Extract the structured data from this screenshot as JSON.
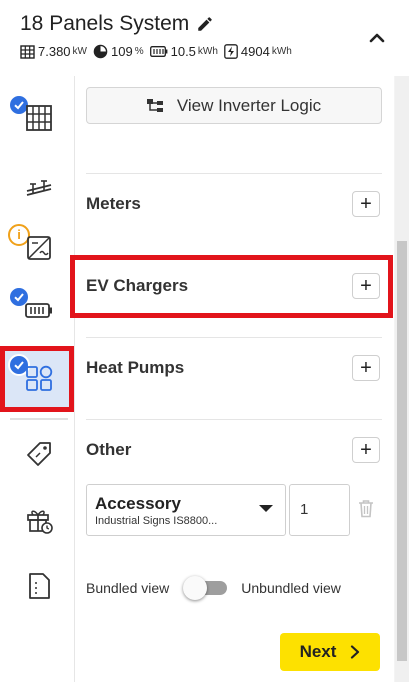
{
  "header": {
    "title": "18 Panels System",
    "stats": [
      {
        "icon": "solar-panel-grid-icon",
        "value": "7.380",
        "unit": "kW"
      },
      {
        "icon": "pie-chart-icon",
        "value": "109",
        "unit": "%"
      },
      {
        "icon": "battery-icon",
        "value": "10.5",
        "unit": "kWh"
      },
      {
        "icon": "lightning-box-icon",
        "value": "4904",
        "unit": "kWh"
      }
    ]
  },
  "sidebar": {
    "items": [
      {
        "icon": "solar-panels-icon",
        "status": "complete"
      },
      {
        "icon": "mounting-rails-icon",
        "status": "none"
      },
      {
        "icon": "inverter-icon",
        "status": "warning"
      },
      {
        "icon": "battery-icon",
        "status": "complete"
      },
      {
        "icon": "add-ons-icon",
        "status": "complete",
        "active": true
      },
      {
        "icon": "price-tag-icon",
        "status": "none"
      },
      {
        "icon": "incentives-gift-icon",
        "status": "none"
      },
      {
        "icon": "document-icon",
        "status": "none"
      }
    ]
  },
  "main": {
    "inverter_logic_label": "View Inverter Logic",
    "sections": [
      {
        "label": "Meters"
      },
      {
        "label": "EV Chargers"
      },
      {
        "label": "Heat Pumps"
      },
      {
        "label": "Other"
      }
    ],
    "accessory": {
      "title": "Accessory",
      "subtitle": "Industrial Signs IS8800...",
      "quantity": "1"
    },
    "toggle": {
      "left_label": "Bundled view",
      "right_label": "Unbundled view"
    },
    "next_label": "Next"
  },
  "colors": {
    "accent_blue": "#2f6fe0",
    "highlight_red": "#e2141b",
    "warning_orange": "#f0a11a",
    "next_yellow": "#fde100"
  }
}
